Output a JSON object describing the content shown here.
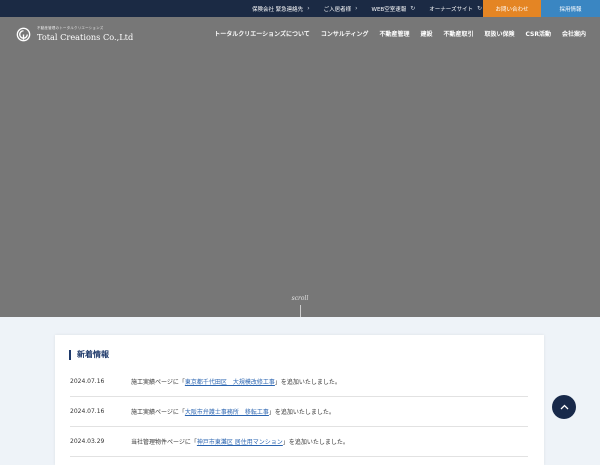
{
  "topbar": {
    "links": [
      {
        "label": "保険会社 緊急連絡先",
        "icon": "›"
      },
      {
        "label": "ご入居者様",
        "icon": "›"
      },
      {
        "label": "WEB空室速報",
        "icon": "↻"
      },
      {
        "label": "オーナーズサイト",
        "icon": "↻"
      }
    ],
    "contact_label": "お問い合わせ",
    "recruit_label": "採用情報"
  },
  "logo": {
    "tagline": "不動産管理のトータルクリエーションズ",
    "name": "Total Creations Co.,Ltd"
  },
  "nav": {
    "items": [
      "トータルクリエーションズについて",
      "コンサルティング",
      "不動産管理",
      "建設",
      "不動産取引",
      "取扱い保険",
      "CSR活動",
      "会社案内"
    ]
  },
  "hero": {
    "scroll_label": "scroll"
  },
  "news": {
    "title": "新着情報",
    "items": [
      {
        "date": "2024.07.16",
        "prefix": "施工実績ページに「",
        "link": "東京都千代田区　大規模改修工事",
        "suffix": "」を追加いたしました。"
      },
      {
        "date": "2024.07.16",
        "prefix": "施工実績ページに「",
        "link": "大阪市弁護士事務所　移転工事",
        "suffix": "」を追加いたしました。"
      },
      {
        "date": "2024.03.29",
        "prefix": "当社管理物件ページに「",
        "link": "神戸市東灘区 居住用マンション",
        "suffix": "」を追加いたしました。"
      }
    ]
  },
  "colors": {
    "topbar": "#1b2a44",
    "contact": "#e48524",
    "recruit": "#3a86c2",
    "hero": "#777777",
    "accent": "#1f3a6b",
    "link": "#2a64b0"
  }
}
